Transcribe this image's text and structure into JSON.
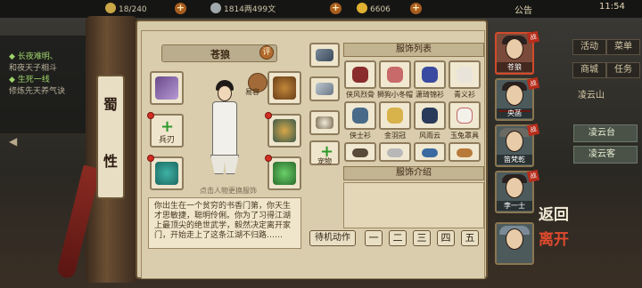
{
  "topbar": {
    "res1": "18/240",
    "res2": "1814两499文",
    "res3": "6606",
    "notice": "公告",
    "time": "11:54"
  },
  "left_quests": [
    {
      "text": "◆ 长夜难明、",
      "type": "title"
    },
    {
      "text": "和夜天子相斗",
      "type": "desc"
    },
    {
      "text": "◆ 生死一线",
      "type": "title"
    },
    {
      "text": "修炼先天养气诀",
      "type": "desc"
    }
  ],
  "side_menu": {
    "buttons": [
      "活动",
      "菜单",
      "商城",
      "任务"
    ],
    "location_label": "凌云山",
    "locations": [
      "凌云台",
      "凌云客"
    ]
  },
  "scroll_label": [
    "蜀",
    "性"
  ],
  "character": {
    "name": "苍狼",
    "rate_label": "评",
    "avatar_label": "易容",
    "hint": "点击人物更换服饰"
  },
  "equipment": {
    "weapon_label": "兵刃",
    "pet_label": "宠物"
  },
  "description": "你出生在一个贫穷的书香门第，你天生才思敏捷，聪明伶俐。你为了习得江湖上最顶尖的绝世武学，毅然决定离开家门，开始走上了这条江湖不归路……",
  "costume_list": {
    "title": "服饰列表",
    "items": [
      "侠风烈骨",
      "狮狗小冬帽",
      "潇琦锦衫",
      "青义衫",
      "侠士衫",
      "金羽冠",
      "风雨云",
      "玉兔罩具"
    ]
  },
  "costume_intro": {
    "title": "服饰介绍"
  },
  "actions": {
    "idle_label": "待机动作",
    "numbers": [
      "一",
      "二",
      "三",
      "四",
      "五"
    ]
  },
  "party": [
    {
      "name": "苍狼",
      "selected": true
    },
    {
      "name": "央菡",
      "selected": false
    },
    {
      "name": "笛梵乾",
      "selected": false
    },
    {
      "name": "李一士",
      "selected": false
    },
    {
      "name": "",
      "selected": false
    }
  ],
  "seal_label": "战",
  "back_button": {
    "line1": "返回",
    "line2": "离开"
  },
  "colors": {
    "paper": "#d9cdad",
    "accent_red": "#d32e22",
    "frame": "#8e7c5d"
  }
}
